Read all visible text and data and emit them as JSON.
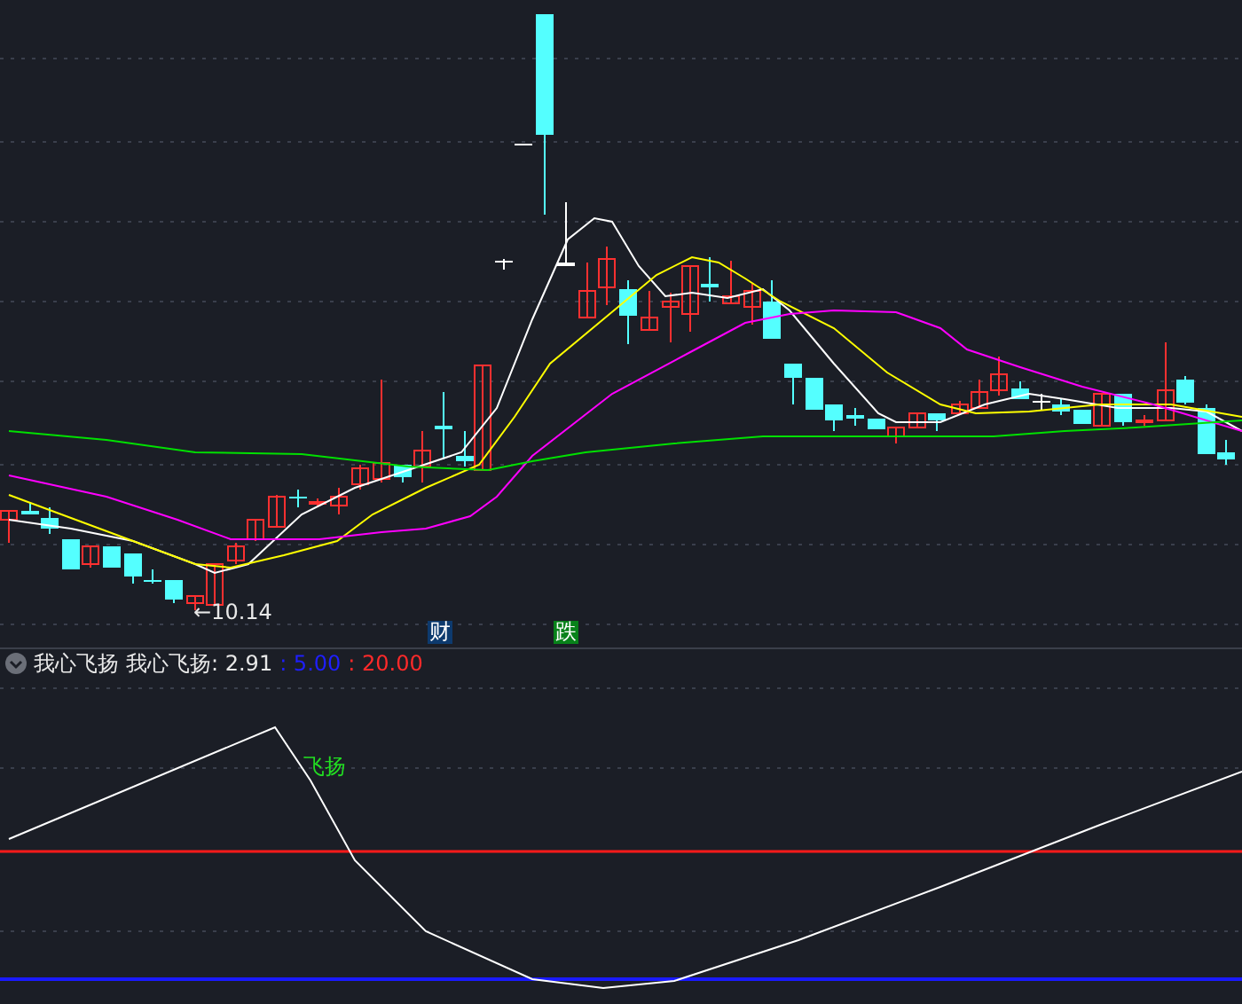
{
  "main_chart": {
    "low_marker": "←10.14",
    "signals": [
      {
        "label": "财",
        "color": "#0d3a6e"
      },
      {
        "label": "跌",
        "color": "#08821a"
      }
    ]
  },
  "indicator": {
    "title": "我心飞扬",
    "values": [
      {
        "text": "我心飞扬: 2.91",
        "color": "#e8e8e8"
      },
      {
        "text": ": 5.00",
        "color": "#1f1fff"
      },
      {
        "text": ": 20.00",
        "color": "#ff2a2a"
      }
    ],
    "line_label": "飞扬"
  }
}
